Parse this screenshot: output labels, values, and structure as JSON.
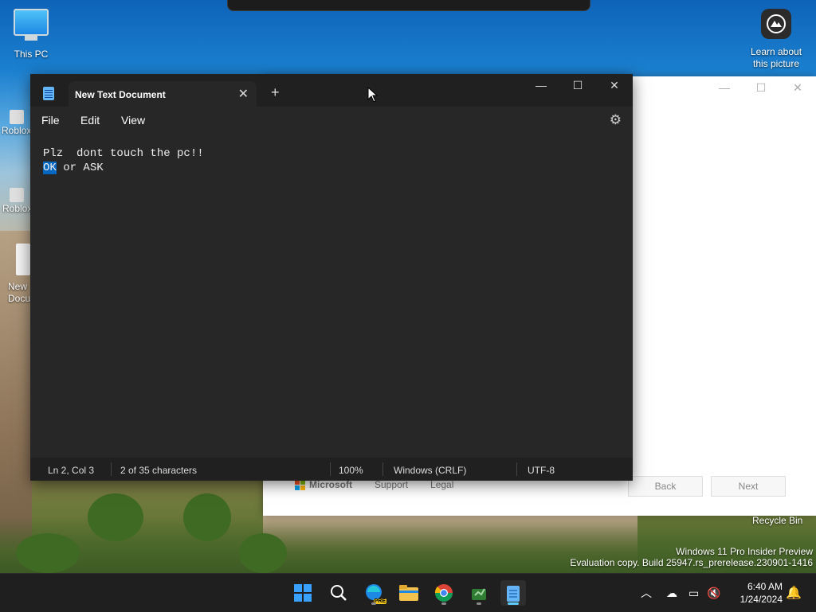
{
  "desktop": {
    "icons": [
      {
        "label": "This PC"
      },
      {
        "label": "Learn about this picture"
      },
      {
        "label": "Roblox"
      },
      {
        "label": "Roblox"
      },
      {
        "label": "New Docu"
      }
    ],
    "recycle_bin_label": "Recycle Bin",
    "watermark": {
      "line1": "Windows 11 Pro Insider Preview",
      "line2": "Evaluation copy. Build 25947.rs_prerelease.230901-1416"
    }
  },
  "background_window": {
    "footer_links": [
      "Microsoft",
      "Support",
      "Legal"
    ],
    "back_label": "Back",
    "next_label": "Next"
  },
  "notepad": {
    "tab_title": "New Text Document",
    "menu": [
      "File",
      "Edit",
      "View"
    ],
    "content": {
      "line1": "Plz  dont touch the pc!!",
      "line2_selected": "OK",
      "line2_rest": " or ASK"
    },
    "status": {
      "position": "Ln 2, Col 3",
      "selection": "2 of 35 characters",
      "zoom": "100%",
      "line_ending": "Windows (CRLF)",
      "encoding": "UTF-8"
    }
  },
  "taskbar": {
    "apps": [
      "start-icon",
      "search-icon",
      "edge-icon",
      "file-explorer-icon",
      "chrome-icon",
      "app-icon",
      "notepad-icon"
    ],
    "edge_badge": "PRE",
    "clock": {
      "time": "6:40 AM",
      "date": "1/24/2024"
    }
  },
  "colors": {
    "accent": "#0067c0",
    "notepad_bg": "#272727",
    "taskbar_bg": "#1f1f1f"
  }
}
